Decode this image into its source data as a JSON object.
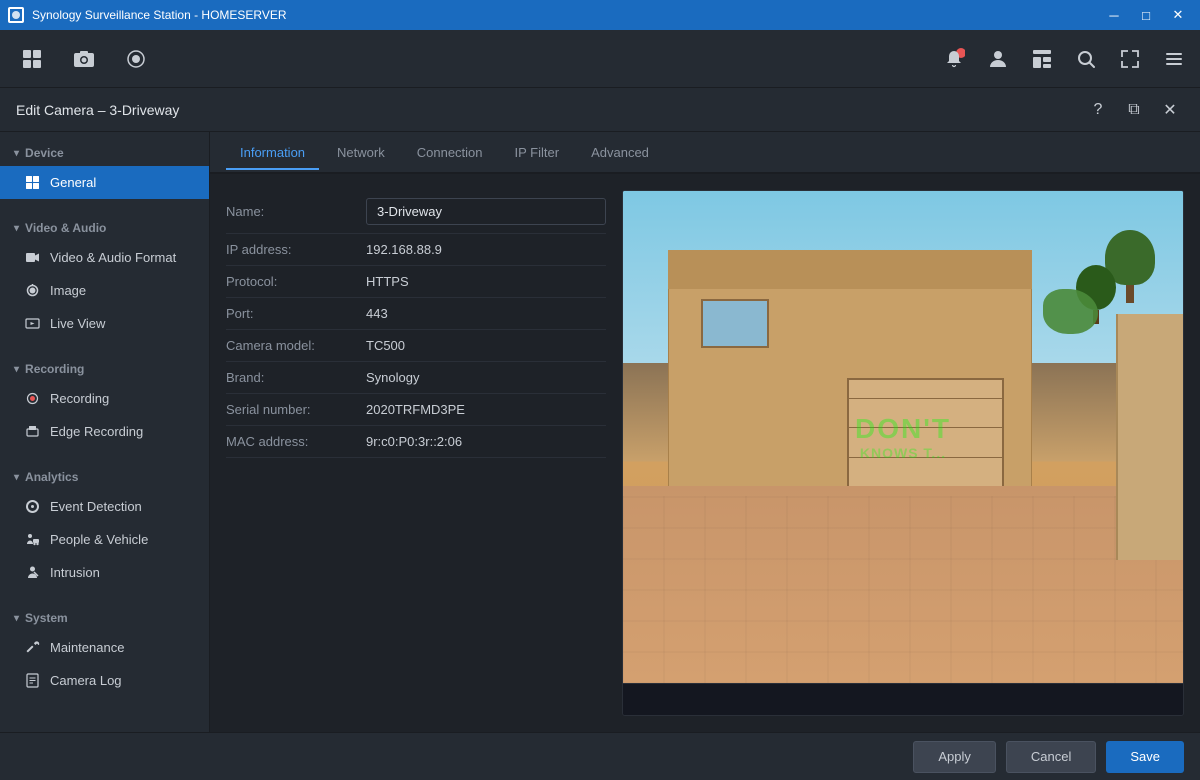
{
  "titleBar": {
    "title": "Synology Surveillance Station - HOMESERVER",
    "controls": {
      "minimize": "─",
      "maximize": "□",
      "close": "✕"
    }
  },
  "toolbar": {
    "items": [
      {
        "label": "",
        "icon": "grid"
      },
      {
        "label": "",
        "icon": "camera"
      },
      {
        "label": "",
        "icon": "record"
      }
    ],
    "rightIcons": [
      "person-red",
      "person",
      "layout",
      "search",
      "expand",
      "menu"
    ]
  },
  "dialog": {
    "title": "Edit Camera – 3-Driveway",
    "help": "?",
    "restore": "⧉",
    "close": "✕"
  },
  "sidebar": {
    "sections": [
      {
        "name": "Device",
        "items": [
          {
            "label": "General",
            "active": true
          }
        ]
      },
      {
        "name": "Video & Audio",
        "items": [
          {
            "label": "Video & Audio Format",
            "active": false
          },
          {
            "label": "Image",
            "active": false
          },
          {
            "label": "Live View",
            "active": false
          }
        ]
      },
      {
        "name": "Recording",
        "items": [
          {
            "label": "Recording",
            "active": false
          },
          {
            "label": "Edge Recording",
            "active": false
          }
        ]
      },
      {
        "name": "Analytics",
        "items": [
          {
            "label": "Event Detection",
            "active": false
          },
          {
            "label": "People & Vehicle",
            "active": false
          },
          {
            "label": "Intrusion",
            "active": false
          }
        ]
      },
      {
        "name": "System",
        "items": [
          {
            "label": "Maintenance",
            "active": false
          },
          {
            "label": "Camera Log",
            "active": false
          }
        ]
      }
    ]
  },
  "tabs": [
    {
      "label": "Information",
      "active": true
    },
    {
      "label": "Network",
      "active": false
    },
    {
      "label": "Connection",
      "active": false
    },
    {
      "label": "IP Filter",
      "active": false
    },
    {
      "label": "Advanced",
      "active": false
    }
  ],
  "form": {
    "fields": [
      {
        "label": "Name:",
        "value": "3-Driveway",
        "isInput": true
      },
      {
        "label": "IP address:",
        "value": "192.168.88.9",
        "isInput": false
      },
      {
        "label": "Protocol:",
        "value": "HTTPS",
        "isInput": false
      },
      {
        "label": "Port:",
        "value": "443",
        "isInput": false
      },
      {
        "label": "Camera model:",
        "value": "TC500",
        "isInput": false
      },
      {
        "label": "Brand:",
        "value": "Synology",
        "isInput": false
      },
      {
        "label": "Serial number:",
        "value": "2020TRFMD3PE",
        "isInput": false
      },
      {
        "label": "MAC address:",
        "value": "9r:c0:P0:3r::2:06",
        "isInput": false
      }
    ]
  },
  "watermark": {
    "line1": "DON'T",
    "line2": "KNOWS T..."
  },
  "footer": {
    "apply": "Apply",
    "cancel": "Cancel",
    "save": "Save"
  }
}
